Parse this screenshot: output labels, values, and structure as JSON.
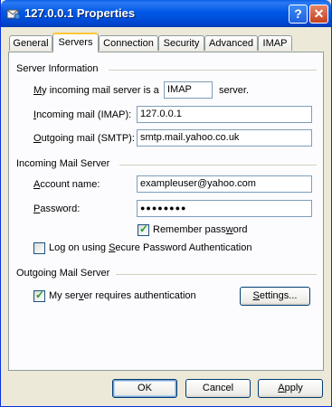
{
  "window": {
    "title": "127.0.0.1 Properties",
    "help_glyph": "?",
    "close_glyph": "✕"
  },
  "tabs": [
    {
      "label": "General",
      "active": false
    },
    {
      "label": "Servers",
      "active": true
    },
    {
      "label": "Connection",
      "active": false
    },
    {
      "label": "Security",
      "active": false
    },
    {
      "label": "Advanced",
      "active": false
    },
    {
      "label": "IMAP",
      "active": false
    }
  ],
  "server_info": {
    "group_title": "Server Information",
    "incoming_type_prefix": "My incoming mail server is a",
    "incoming_type_value": "IMAP",
    "incoming_type_suffix": "server.",
    "incoming_label": "Incoming mail (IMAP):",
    "incoming_value": "127.0.0.1",
    "outgoing_label": "Outgoing mail (SMTP):",
    "outgoing_value": "smtp.mail.yahoo.co.uk"
  },
  "incoming_server": {
    "group_title": "Incoming Mail Server",
    "account_label": "Account name:",
    "account_value": "exampleuser@yahoo.com",
    "password_label": "Password:",
    "password_value": "●●●●●●●●",
    "remember_label": "Remember password",
    "remember_checked": true,
    "spa_label": "Log on using Secure Password Authentication",
    "spa_checked": false
  },
  "outgoing_server": {
    "group_title": "Outgoing Mail Server",
    "auth_label": "My server requires authentication",
    "auth_checked": true,
    "settings_label": "Settings..."
  },
  "footer": {
    "ok_label": "OK",
    "cancel_label": "Cancel",
    "apply_label": "Apply"
  }
}
